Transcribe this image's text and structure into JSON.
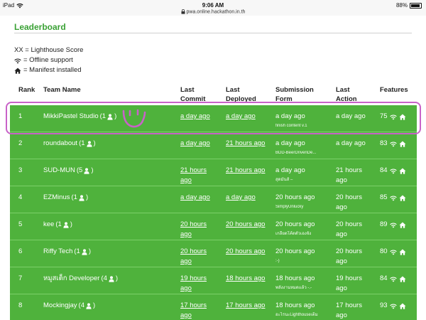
{
  "status": {
    "device": "iPad",
    "time": "9:06 AM",
    "url": "pwa.online.hackathon.in.th",
    "battery": "88%"
  },
  "page": {
    "title": "Leaderboard"
  },
  "legend": {
    "score": "XX = Lighthouse Score",
    "offline": "= Offline support",
    "manifest": "= Manifest installed"
  },
  "columns": {
    "rank": "Rank",
    "team": "Team Name",
    "commit_1": "Last",
    "commit_2": "Commit",
    "deployed_1": "Last",
    "deployed_2": "Deployed",
    "sub_1": "Submission",
    "sub_2": "Form",
    "action_1": "Last",
    "action_2": "Action",
    "features": "Features"
  },
  "rows": [
    {
      "rank": "1",
      "team": "MikkiPastel Studio",
      "members": "(1",
      "commit_1": "a day ago",
      "commit_2": "",
      "deployed_1": "a day ago",
      "deployed_2": "",
      "sub": "a day ago",
      "note": "finish content v.1",
      "action_1": "a day ago",
      "action_2": "",
      "score": "75"
    },
    {
      "rank": "2",
      "team": "roundabout",
      "members": "(1",
      "commit_1": "a day ago",
      "commit_2": "",
      "deployed_1": "21 hours ago",
      "deployed_2": "",
      "sub": "a day ago",
      "note": "BDD-BeerDrivenDe...",
      "action_1": "a day ago",
      "action_2": "",
      "score": "83"
    },
    {
      "rank": "3",
      "team": "SUD-MUN",
      "members": "(5",
      "commit_1": "21 hours",
      "commit_2": "ago",
      "deployed_1": "21 hours ago",
      "deployed_2": "",
      "sub": "a day ago",
      "note": "สุดมันส์ –",
      "action_1": "21 hours",
      "action_2": "ago",
      "score": "84"
    },
    {
      "rank": "4",
      "team": "EZMinus",
      "members": "(1",
      "commit_1": "a day ago",
      "commit_2": "",
      "deployed_1": "a day ago",
      "deployed_2": "",
      "sub": "20 hours ago",
      "note": "SimplyUnlucky",
      "action_1": "20 hours",
      "action_2": "ago",
      "score": "85"
    },
    {
      "rank": "5",
      "team": "kee",
      "members": "(1",
      "commit_1": "20 hours",
      "commit_2": "ago",
      "deployed_1": "20 hours ago",
      "deployed_2": "",
      "sub": "20 hours ago",
      "note": "เกลียดโค้ดตัวเองจัง",
      "action_1": "20 hours",
      "action_2": "ago",
      "score": "89"
    },
    {
      "rank": "6",
      "team": "Riffy Tech",
      "members": "(1",
      "commit_1": "20 hours",
      "commit_2": "ago",
      "deployed_1": "20 hours ago",
      "deployed_2": "",
      "sub": "20 hours ago",
      "note": ":-)",
      "action_1": "20 hours",
      "action_2": "ago",
      "score": "80"
    },
    {
      "rank": "7",
      "team": "หมูสเต็ก Developer",
      "members": "(4",
      "commit_1": "19 hours",
      "commit_2": "ago",
      "deployed_1": "18 hours ago",
      "deployed_2": "",
      "sub": "18 hours ago",
      "note": "พลังงานหมดแล้ว -.-",
      "action_1": "19 hours",
      "action_2": "ago",
      "score": "84"
    },
    {
      "rank": "8",
      "team": "Mockingjay",
      "members": "(4",
      "commit_1": "17 hours",
      "commit_2": "ago",
      "deployed_1": "17 hours ago",
      "deployed_2": "",
      "sub": "18 hours ago",
      "note": "อะไรนะLighthouseเต็ม",
      "action_1": "17 hours",
      "action_2": "ago",
      "score": "93"
    }
  ],
  "colors": {
    "accent": "#3aa135",
    "row_bg": "#4fb23c",
    "annotation": "#c862c8"
  }
}
